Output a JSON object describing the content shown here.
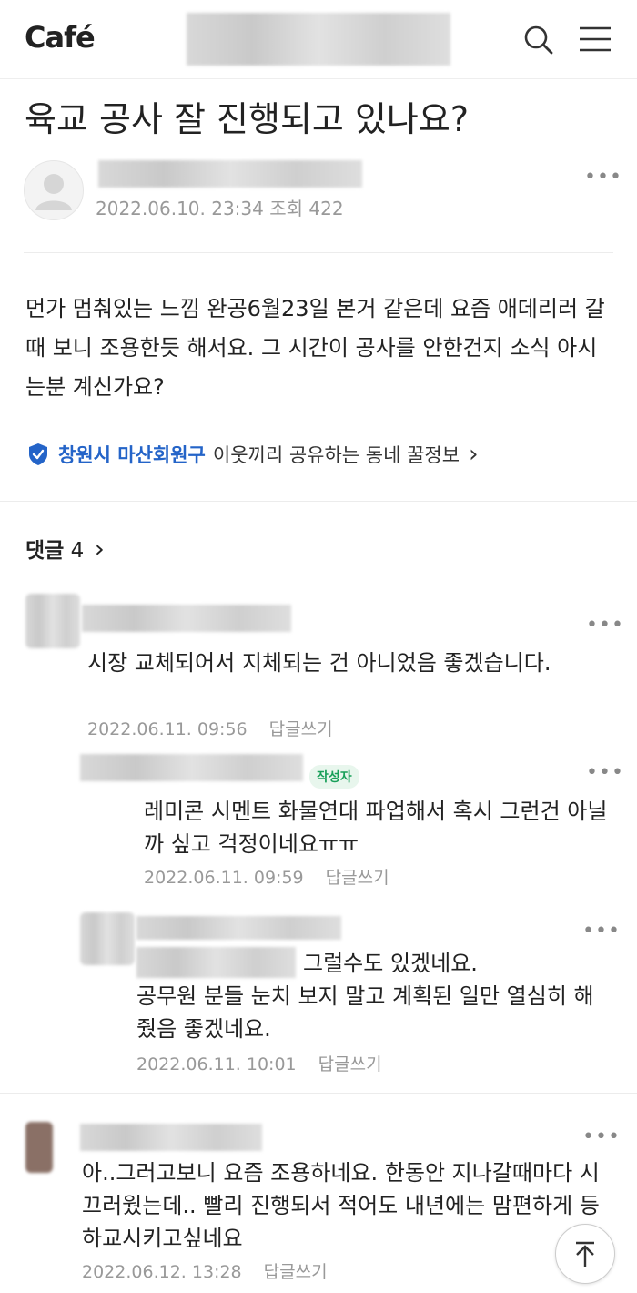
{
  "header": {
    "logo": "Café",
    "search_icon": "search-icon",
    "menu_icon": "hamburger-menu-icon"
  },
  "post": {
    "title": "육교 공사 잘 진행되고 있나요?",
    "date": "2022.06.10. 23:34",
    "views_label": "조회",
    "views": "422",
    "more": "•••",
    "body": "먼가 멈춰있는 느낌   완공6월23일 본거 같은데  요즘 애데리러  갈때 보니  조용한듯 해서요. 그  시간이 공사를 안한건지 소식 아시는분 계신가요?",
    "region": {
      "name": "창원시 마산회원구",
      "desc": "이웃끼리 공유하는 동네 꿀정보",
      "chevron": "›"
    }
  },
  "comments": {
    "label": "댓글",
    "count": "4",
    "chevron": "›",
    "reply_label": "답글쓰기",
    "author_badge": "작성자",
    "items": [
      {
        "text": "시장 교체되어서 지체되는 건 아니었음 좋겠습니다.",
        "date": "2022.06.11. 09:56"
      },
      {
        "text": "레미콘 시멘트 화물연대 파업해서 혹시 그런건 아닐까 싶고 걱정이네요ㅠㅠ",
        "date": "2022.06.11. 09:59"
      },
      {
        "text_line1": "그럴수도 있겠네요.",
        "text_rest": "공무원 분들 눈치 보지 말고 계획된 일만 열심히 해줬음 좋겠네요.",
        "date": "2022.06.11. 10:01"
      },
      {
        "text": "아..그러고보니 요즘 조용하네요. 한동안 지나갈때마다 시끄러웠는데.. 빨리 진행되서 적어도 내년에는 맘편하게 등하교시키고싶네요",
        "date": "2022.06.12. 13:28"
      }
    ]
  },
  "colors": {
    "accent_blue": "#2464c8",
    "badge_green": "#19a05a"
  }
}
